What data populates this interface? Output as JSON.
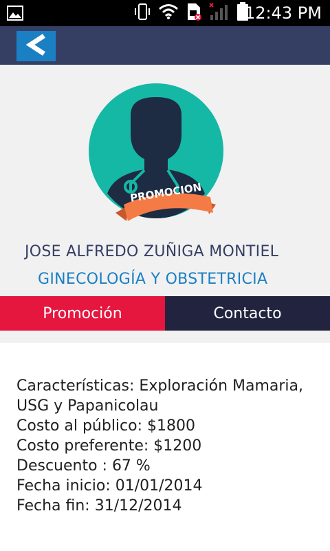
{
  "status_bar": {
    "time": "12:43 PM",
    "icons": [
      "image-icon",
      "vibrate-icon",
      "wifi-icon",
      "sim-icon",
      "signal-icon",
      "battery-icon"
    ]
  },
  "app_bar": {
    "back_label": "<",
    "color": "#353f64",
    "back_color": "#1b7fc4"
  },
  "profile": {
    "badge": "PROMOCION",
    "name": "JOSE ALFREDO ZUÑIGA MONTIEL",
    "specialty": "GINECOLOGÍA Y OBSTETRICIA",
    "avatar_color": "#15b8a5",
    "badge_color": "#f47b45"
  },
  "tabs": [
    {
      "label": "Promoción",
      "active": true
    },
    {
      "label": "Contacto",
      "active": false
    }
  ],
  "promotion": {
    "caracteristicas": "Características: Exploración Mamaria, USG y Papanicolau",
    "costo_publico": "Costo al público: $1800",
    "costo_preferente": "Costo preferente: $1200",
    "descuento": "Descuento : 67 %",
    "fecha_inicio": "Fecha inicio: 01/01/2014",
    "fecha_fin": "Fecha fin: 31/12/2014"
  }
}
